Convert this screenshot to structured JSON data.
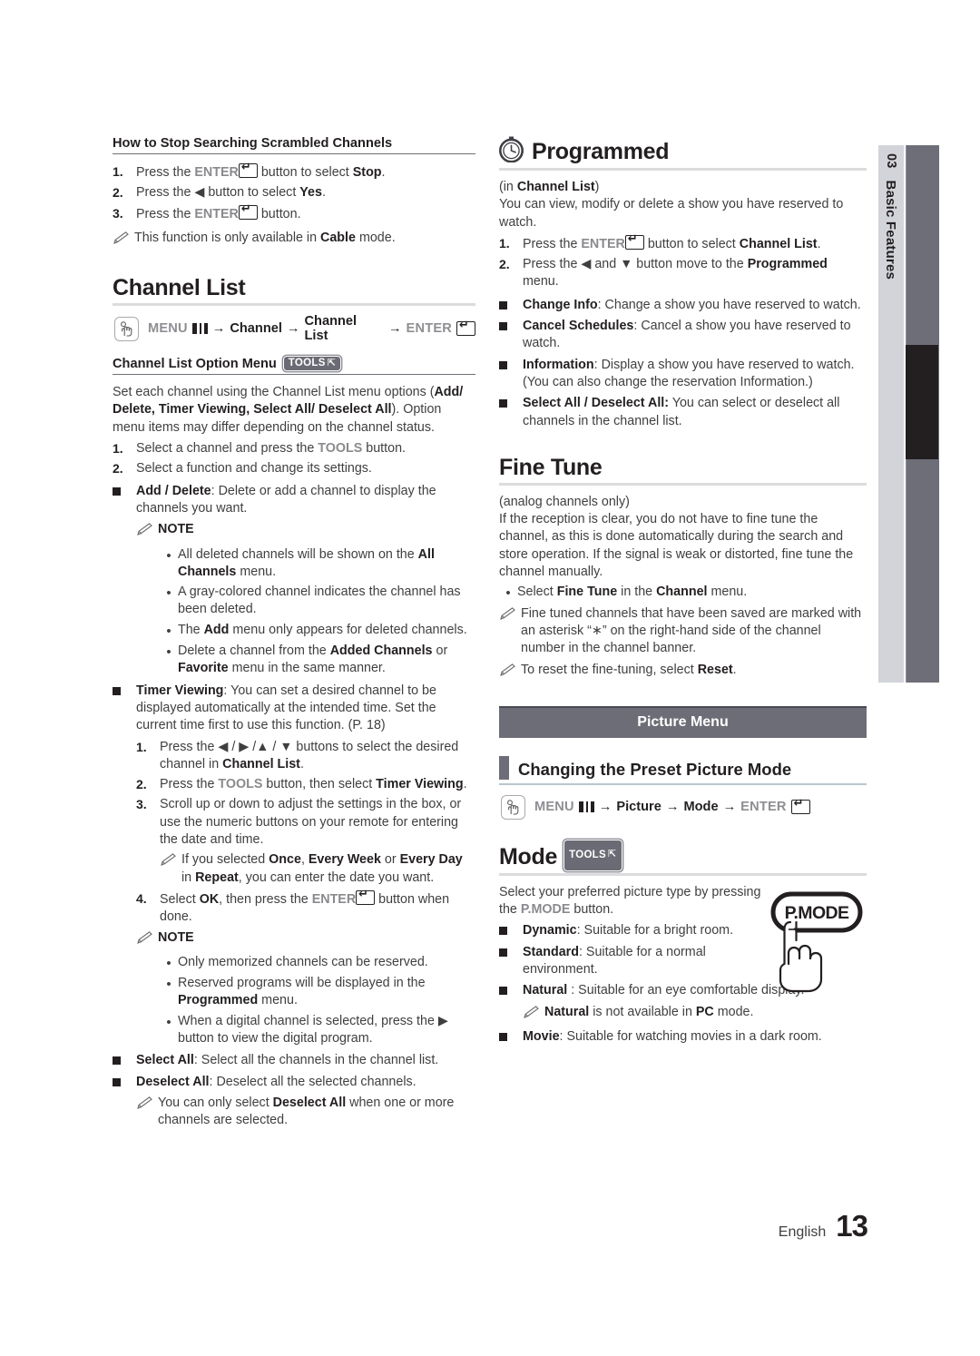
{
  "colors": {
    "band": "#6d6d77",
    "sidebar_light": "#d2d4d9",
    "sidebar_bar": "#6e6e78",
    "sidebar_black": "#231f20",
    "rule": "#dcdcde"
  },
  "sidebar": {
    "number": "03",
    "label": "Basic Features"
  },
  "footer": {
    "language": "English",
    "page": "13"
  },
  "left": {
    "scrambled": {
      "heading": "How to Stop Searching Scrambled Channels",
      "steps": [
        {
          "n": "1.",
          "pre": "Press the ",
          "key": "ENTER",
          "post": " button to select ",
          "bold": "Stop",
          "tail": "."
        },
        {
          "n": "2.",
          "pre": "Press the ◀ button to select ",
          "bold": "Yes",
          "tail": "."
        },
        {
          "n": "3.",
          "pre": "Press the ",
          "key": "ENTER",
          "post": " button.",
          "bold": "",
          "tail": ""
        }
      ],
      "note": {
        "pre": "This function is only available in ",
        "bold": "Cable",
        "post": " mode."
      }
    },
    "channel_list": {
      "title": "Channel List",
      "navpath": {
        "menu": "MENU",
        "items": [
          "Channel",
          "Channel List"
        ],
        "enter": "ENTER"
      },
      "option_menu_heading": "Channel List Option Menu",
      "tools_badge": "TOOLS",
      "intro_1_a": "Set each channel using the Channel List menu options (",
      "intro_1_b": "Add/ Delete, Timer Viewing, Select All/ Deselect All",
      "intro_1_c": "). Option menu items may differ depending on the channel status.",
      "steps": [
        {
          "n": "1.",
          "pre": "Select a channel and press the ",
          "gray": "TOOLS",
          "post": " button."
        },
        {
          "n": "2.",
          "pre": "Select a function and change its settings.",
          "gray": "",
          "post": ""
        }
      ],
      "add_delete": {
        "bold": "Add / Delete",
        "text": ": Delete or add a channel to display the channels you want."
      },
      "note_label": "NOTE",
      "add_delete_notes": [
        {
          "a": "All deleted channels will be shown on the ",
          "b": "All Channels",
          "c": " menu."
        },
        {
          "a": "A gray-colored channel indicates the channel has been deleted.",
          "b": "",
          "c": ""
        },
        {
          "a": "The ",
          "b": "Add",
          "c": " menu only appears for deleted channels."
        },
        {
          "a": "Delete a channel from the ",
          "b": "Added Channels",
          "c": " or ",
          "d": "Favorite",
          "e": " menu in the same manner."
        }
      ],
      "timer_viewing": {
        "bold": "Timer Viewing",
        "text": ": You can set a desired channel to be displayed automatically at the intended time. Set the current time first to use this function. (P. 18)"
      },
      "timer_steps": [
        {
          "n": "1.",
          "a": "Press the ◀ / ▶ /▲ / ▼ buttons to select the desired channel in ",
          "b": "Channel List",
          "c": "."
        },
        {
          "n": "2.",
          "a": "Press the ",
          "gray": "TOOLS",
          "b2": " button, then select ",
          "b": "Timer Viewing",
          "c": "."
        },
        {
          "n": "3.",
          "a": "Scroll up or down to adjust the settings in the box, or use the numeric buttons on your remote for entering the date and time.",
          "b": "",
          "c": ""
        }
      ],
      "timer_note": {
        "a": "If you selected ",
        "b": "Once",
        "c": ", ",
        "d": "Every Week",
        "e": " or ",
        "f": "Every Day",
        "g": " in ",
        "h": "Repeat",
        "i": ", you can enter the date you want."
      },
      "timer_step4": {
        "n": "4.",
        "a": "Select ",
        "b": "OK",
        "c": ", then press the ",
        "key": "ENTER",
        "d": " button when done."
      },
      "notes2_label": "NOTE",
      "timer_notes": [
        {
          "a": "Only memorized channels can be reserved.",
          "b": "",
          "c": ""
        },
        {
          "a": "Reserved programs will be displayed in the ",
          "b": "Programmed",
          "c": " menu."
        },
        {
          "a": "When a digital channel is selected, press the ▶ button to view the digital program.",
          "b": "",
          "c": ""
        }
      ],
      "select_all": {
        "bold": "Select All",
        "text": ": Select all the channels in the channel list."
      },
      "deselect_all": {
        "bold": "Deselect All",
        "text": ": Deselect all the selected channels."
      },
      "deselect_note": {
        "a": "You can only select ",
        "b": "Deselect All",
        "c": " when one or more channels are selected."
      }
    }
  },
  "right": {
    "programmed": {
      "icon": "clock-icon",
      "title": "Programmed",
      "subtitle_a": "(in ",
      "subtitle_b": "Channel List",
      "subtitle_c": ")",
      "intro": "You can view, modify or delete a show you have reserved to watch.",
      "steps": [
        {
          "n": "1.",
          "a": "Press the ",
          "key": "ENTER",
          "b": " button to select ",
          "bold": "Channel List",
          "c": "."
        },
        {
          "n": "2.",
          "a": "Press the ◀ and ▼ button move to the ",
          "bold": "Programmed",
          "c": " menu."
        }
      ],
      "items": [
        {
          "bold": "Change Info",
          "text": ": Change a show you have reserved to watch."
        },
        {
          "bold": "Cancel Schedules",
          "text": ": Cancel a show you have reserved to watch."
        },
        {
          "bold": "Information",
          "text": ": Display a show you have reserved to watch. (You can also change the reservation Information.)"
        },
        {
          "bold": "Select All / Deselect All:",
          "text": " You can select or deselect all channels in the channel list."
        }
      ]
    },
    "fine_tune": {
      "title": "Fine Tune",
      "subtitle": "(analog channels only)",
      "body": "If the reception is clear, you do not have to fine tune the channel, as this is done automatically during the search and store operation. If the signal is weak or distorted, fine tune the channel manually.",
      "bullet": {
        "a": "Select ",
        "b": "Fine Tune",
        "c": " in the ",
        "d": "Channel",
        "e": " menu."
      },
      "note1": "Fine tuned channels that have been saved are marked with an asterisk “∗” on the right-hand side of the channel number in the channel banner.",
      "note2": {
        "a": "To reset the fine-tuning, select ",
        "b": "Reset",
        "c": "."
      }
    },
    "picture_menu_band": "Picture Menu",
    "preset": {
      "title": "Changing the Preset Picture Mode",
      "navpath": {
        "menu": "MENU",
        "items": [
          "Picture",
          "Mode"
        ],
        "enter": "ENTER"
      }
    },
    "mode": {
      "title": "Mode",
      "tools_badge": "TOOLS",
      "intro_a": "Select your preferred picture type by pressing the ",
      "intro_b": "P.MODE",
      "intro_c": " button.",
      "pmode_button_label": "P.MODE",
      "items": [
        {
          "bold": "Dynamic",
          "text": ": Suitable for a bright room."
        },
        {
          "bold": "Standard",
          "text": ": Suitable for a normal environment."
        },
        {
          "bold": "Natural",
          "text": " : Suitable for an eye comfortable display."
        },
        {
          "bold": "Movie",
          "text": ": Suitable for watching movies in a dark room."
        }
      ],
      "natural_note": {
        "a": "Natural",
        " b": "",
        "b": " is not available in ",
        "c": "PC",
        "d": " mode."
      }
    }
  }
}
